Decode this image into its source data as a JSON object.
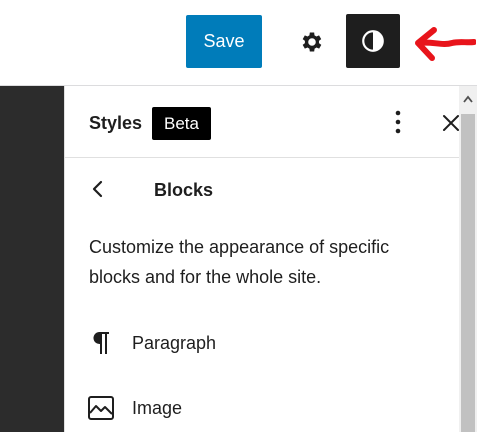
{
  "toolbar": {
    "save_label": "Save",
    "accent_color": "#007cba",
    "settings_icon": "gear-icon",
    "styles_icon": "contrast-icon"
  },
  "annotation": {
    "color": "#e8141b",
    "icon": "arrow-left-icon"
  },
  "sidebar": {
    "title": "Styles",
    "badge": "Beta",
    "more_icon": "more-vertical-icon",
    "close_icon": "close-icon",
    "nav": {
      "back_icon": "chevron-left-icon",
      "title": "Blocks"
    },
    "description": "Customize the appearance of specific blocks and for the whole site.",
    "blocks": [
      {
        "label": "Paragraph",
        "icon": "paragraph-icon"
      },
      {
        "label": "Image",
        "icon": "image-icon"
      }
    ]
  }
}
